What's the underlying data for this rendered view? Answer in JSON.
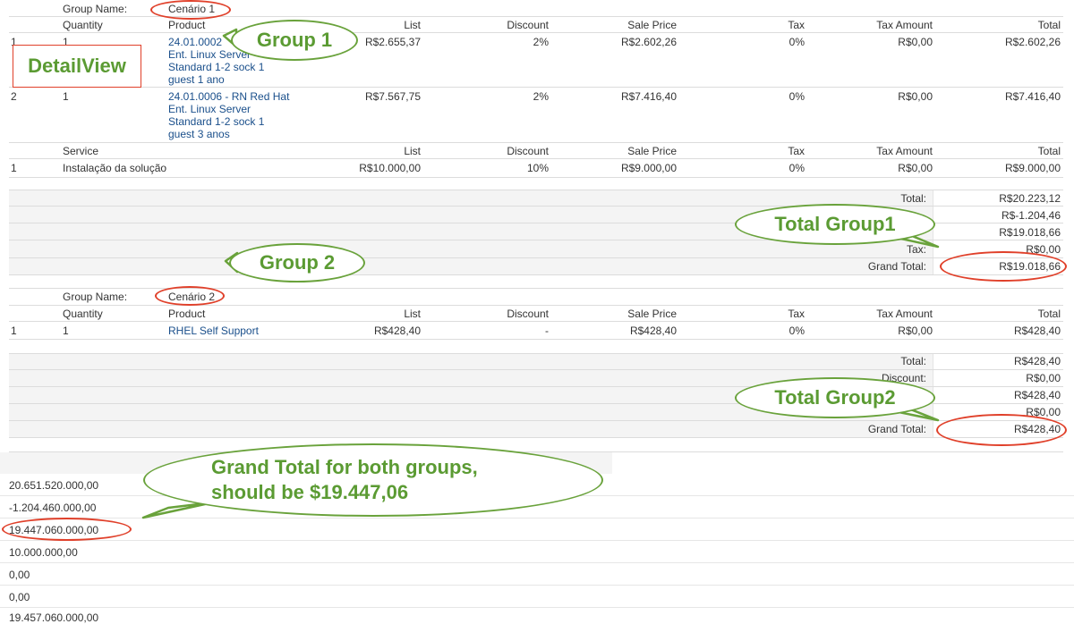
{
  "group1": {
    "name_label": "Group Name:",
    "name_value": "Cenário 1",
    "columns": {
      "quantity": "Quantity",
      "product": "Product",
      "list": "List",
      "discount": "Discount",
      "sale_price": "Sale Price",
      "tax": "Tax",
      "tax_amount": "Tax Amount",
      "total": "Total"
    },
    "rows": [
      {
        "num": "1",
        "qty": "1",
        "product_lines": [
          "24.01.0002",
          "Ent. Linux Server",
          "Standard 1-2 sock 1",
          "guest 1 ano"
        ],
        "list": "R$2.655,37",
        "discount": "2%",
        "sale_price": "R$2.602,26",
        "tax": "0%",
        "tax_amount": "R$0,00",
        "total": "R$2.602,26"
      },
      {
        "num": "2",
        "qty": "1",
        "product_lines": [
          "24.01.0006 - RN Red Hat",
          "Ent. Linux Server",
          "Standard 1-2 sock 1",
          "guest 3 anos"
        ],
        "list": "R$7.567,75",
        "discount": "2%",
        "sale_price": "R$7.416,40",
        "tax": "0%",
        "tax_amount": "R$0,00",
        "total": "R$7.416,40"
      }
    ],
    "service_columns": {
      "service": "Service",
      "list": "List",
      "discount": "Discount",
      "sale_price": "Sale Price",
      "tax": "Tax",
      "tax_amount": "Tax Amount",
      "total": "Total"
    },
    "service_rows": [
      {
        "num": "1",
        "service": "Instalação da solução",
        "list": "R$10.000,00",
        "discount": "10%",
        "sale_price": "R$9.000,00",
        "tax": "0%",
        "tax_amount": "R$0,00",
        "total": "R$9.000,00"
      }
    ],
    "totals": [
      {
        "label": "Total:",
        "value": "R$20.223,12"
      },
      {
        "label": "",
        "value": "R$-1.204,46"
      },
      {
        "label": "",
        "value": "R$19.018,66"
      },
      {
        "label": "Tax:",
        "value": "R$0,00"
      },
      {
        "label": "Grand Total:",
        "value": "R$19.018,66"
      }
    ]
  },
  "group2": {
    "name_label": "Group Name:",
    "name_value": "Cenário 2",
    "columns": {
      "quantity": "Quantity",
      "product": "Product",
      "list": "List",
      "discount": "Discount",
      "sale_price": "Sale Price",
      "tax": "Tax",
      "tax_amount": "Tax Amount",
      "total": "Total"
    },
    "rows": [
      {
        "num": "1",
        "qty": "1",
        "product": "RHEL Self Support",
        "list": "R$428,40",
        "discount": "-",
        "sale_price": "R$428,40",
        "tax": "0%",
        "tax_amount": "R$0,00",
        "total": "R$428,40"
      }
    ],
    "totals": [
      {
        "label": "Total:",
        "value": "R$428,40"
      },
      {
        "label": "Discount:",
        "value": "R$0,00"
      },
      {
        "label": "",
        "value": "R$428,40"
      },
      {
        "label": "",
        "value": "R$0,00"
      },
      {
        "label": "Grand Total:",
        "value": "R$428,40"
      }
    ]
  },
  "bottom_values": [
    "20.651.520.000,00",
    "-1.204.460.000,00",
    "19.447.060.000,00",
    "10.000.000,00",
    "0,00",
    "0,00",
    "19.457.060.000,00"
  ],
  "annotations": {
    "detailview": "DetailView",
    "group1": "Group 1",
    "group2": "Group 2",
    "total_group1": "Total Group1",
    "total_group2": "Total Group2",
    "grand_total_line1": "Grand Total for both groups,",
    "grand_total_line2": "should be $19.447,06"
  },
  "colors": {
    "annotation_green": "#5b9b33",
    "highlight_red": "#e0402a",
    "link_blue": "#1a4f8b"
  }
}
